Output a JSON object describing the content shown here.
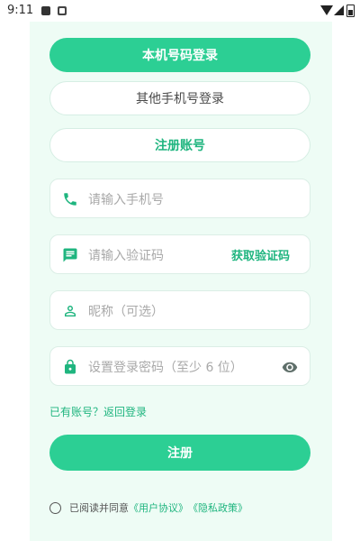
{
  "status_bar": {
    "time": "9:11"
  },
  "login": {
    "local_phone_button": "本机号码登录",
    "other_phone_button": "其他手机号登录",
    "register_account_button": "注册账号"
  },
  "form": {
    "phone_placeholder": "请输入手机号",
    "code_placeholder": "请输入验证码",
    "get_code_label": "获取验证码",
    "nickname_placeholder": "昵称（可选）",
    "password_placeholder": "设置登录密码（至少 6 位）"
  },
  "links": {
    "have_account": "已有账号？返回登录"
  },
  "register_button": "注册",
  "agreement": {
    "prefix": "已阅读并同意",
    "user_agreement": "《用户协议》",
    "privacy_policy": "《隐私政策》"
  },
  "colors": {
    "accent": "#2ccf94",
    "accent_text": "#1fb57f",
    "card_bg": "#eefcf5"
  }
}
